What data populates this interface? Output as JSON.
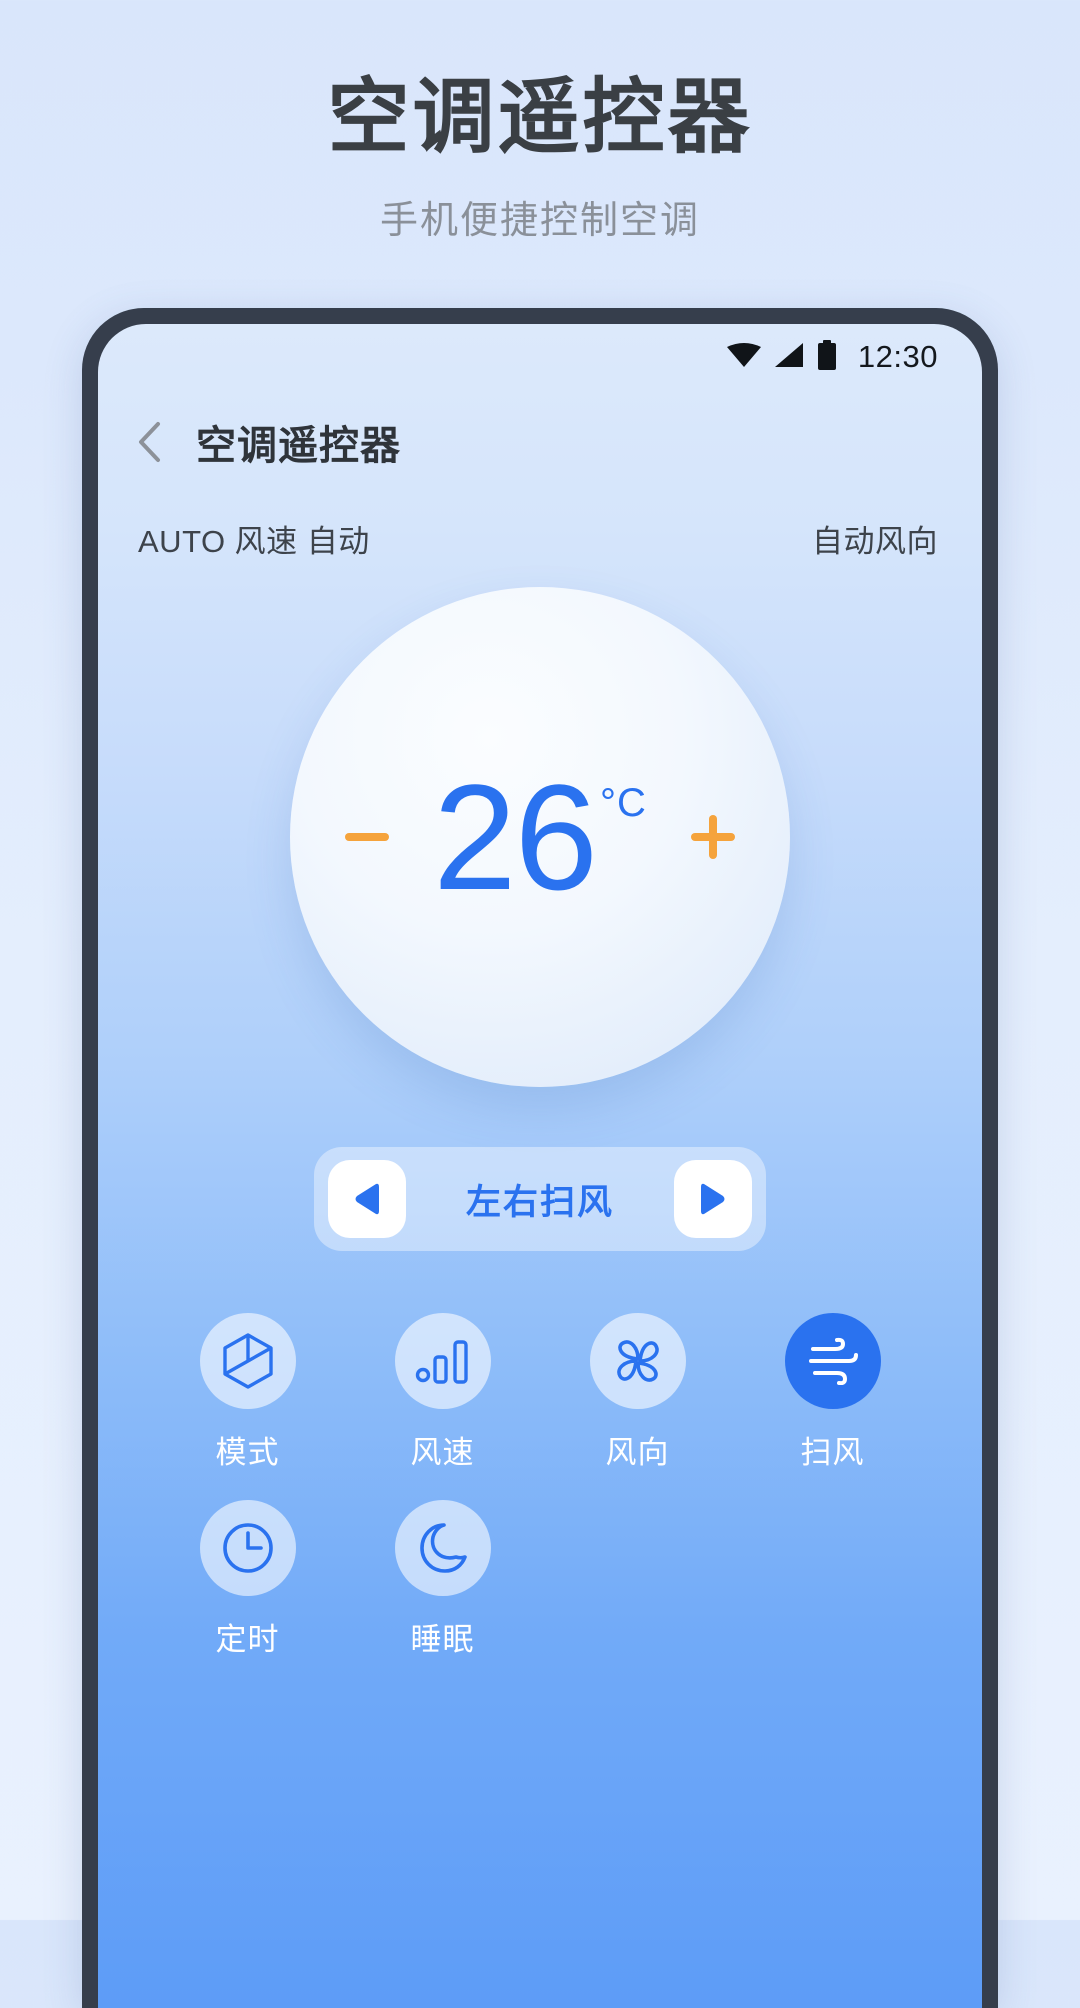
{
  "promo": {
    "title": "空调遥控器",
    "subtitle": "手机便捷控制空调"
  },
  "phone": {
    "status_bar": {
      "time": "12:30",
      "icons": [
        "wifi-icon",
        "cellular-signal-icon",
        "battery-icon"
      ]
    },
    "nav": {
      "back_icon": "chevron-left-icon",
      "title": "空调遥控器"
    },
    "info_row": {
      "left": "AUTO 风速 自动",
      "right": "自动风向"
    },
    "dial": {
      "decrease_icon": "minus-icon",
      "increase_icon": "plus-icon",
      "temperature": "26",
      "unit": "°C",
      "temp_color": "#2a72ef",
      "step_color": "#f5a33c"
    },
    "swing_bar": {
      "prev_icon": "triangle-left-icon",
      "next_icon": "triangle-right-icon",
      "label": "左右扫风",
      "accent": "#2a72ef"
    },
    "functions": [
      {
        "label": "模式",
        "icon": "cube-icon",
        "active": false
      },
      {
        "label": "风速",
        "icon": "signal-bars-icon",
        "active": false
      },
      {
        "label": "风向",
        "icon": "fan-icon",
        "active": false
      },
      {
        "label": "扫风",
        "icon": "wind-icon",
        "active": true
      },
      {
        "label": "定时",
        "icon": "clock-icon",
        "active": false
      },
      {
        "label": "睡眠",
        "icon": "moon-icon",
        "active": false
      }
    ]
  }
}
